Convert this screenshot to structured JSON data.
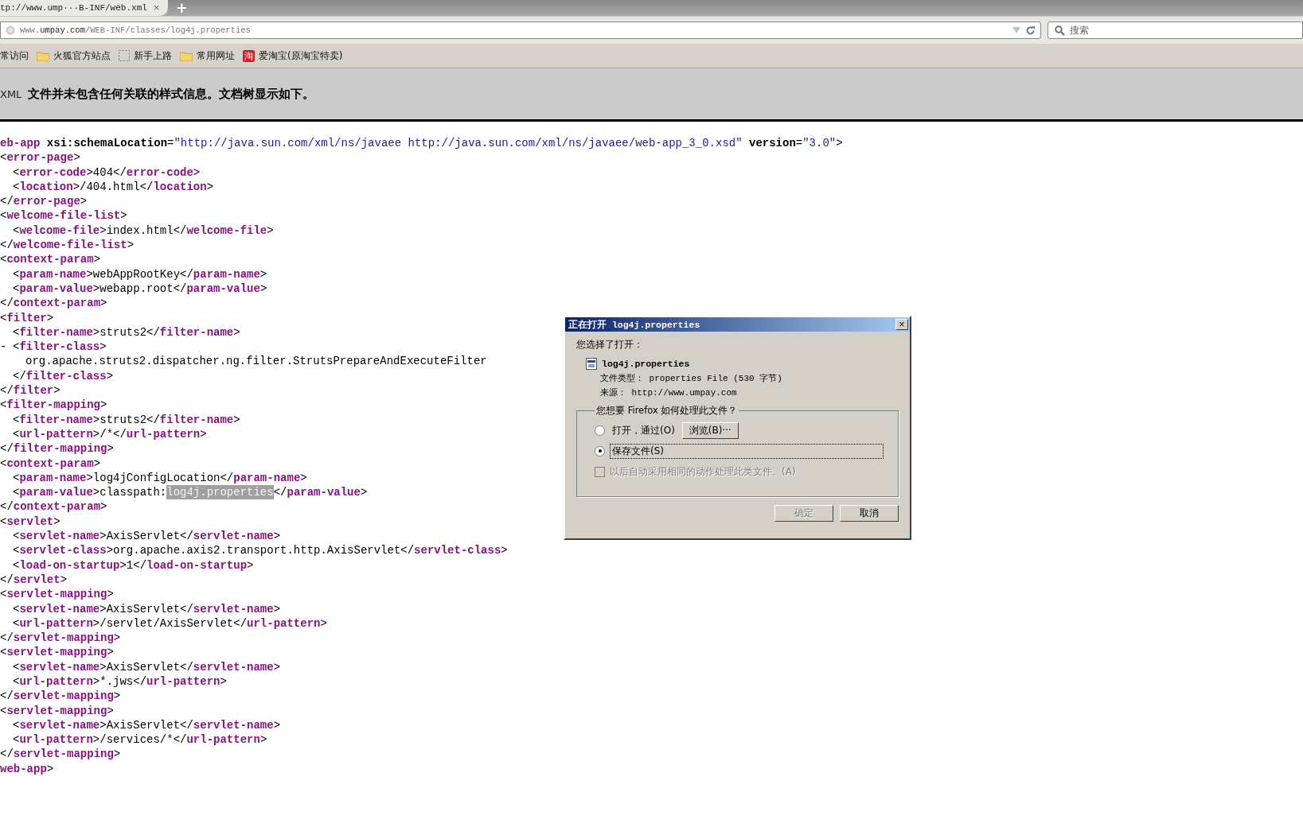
{
  "tab": {
    "title": "tp://www.ump···B-INF/web.xml",
    "close": "×",
    "new_tab": "+"
  },
  "address_bar": {
    "url": "www.**umpay.com**/WEB-INF/classes/log4j.properties"
  },
  "search": {
    "placeholder": "搜索"
  },
  "bookmarks": [
    {
      "kind": "plain",
      "label": "常访问"
    },
    {
      "kind": "folder",
      "label": "火狐官方站点"
    },
    {
      "kind": "blank",
      "label": "新手上路"
    },
    {
      "kind": "folder",
      "label": "常用网址"
    },
    {
      "kind": "badge",
      "badge": "淘",
      "label": "爱淘宝(原淘宝特卖)"
    }
  ],
  "info_bar": {
    "prefix": "XML",
    "message": "文件并未包含任何关联的样式信息。文档树显示如下。"
  },
  "xml": [
    {
      "parts": [
        {
          "kind": "tag",
          "text": "eb-app"
        },
        {
          "kind": "attr",
          "text": " xsi:schemaLocation"
        },
        {
          "kind": "plain",
          "text": "="
        },
        {
          "kind": "value",
          "text": "\"http://java.sun.com/xml/ns/javaee http://java.sun.com/xml/ns/javaee/web-app_3_0.xsd\""
        },
        {
          "kind": "attr",
          "text": " version"
        },
        {
          "kind": "plain",
          "text": "="
        },
        {
          "kind": "value",
          "text": "\"3.0\""
        },
        {
          "kind": "plain",
          "text": ">"
        }
      ]
    },
    {
      "parts": [
        {
          "kind": "plain",
          "text": "<"
        },
        {
          "kind": "tag",
          "text": "error-page"
        },
        {
          "kind": "plain",
          "text": ">"
        }
      ],
      "children": [
        {
          "parts": [
            {
              "kind": "plain",
              "text": "<"
            },
            {
              "kind": "tag",
              "text": "error-code"
            },
            {
              "kind": "plain",
              "text": ">404</"
            },
            {
              "kind": "tag",
              "text": "error-code"
            },
            {
              "kind": "plain",
              "text": ">"
            }
          ]
        },
        {
          "parts": [
            {
              "kind": "plain",
              "text": "<"
            },
            {
              "kind": "tag",
              "text": "location"
            },
            {
              "kind": "plain",
              "text": ">/404.html</"
            },
            {
              "kind": "tag",
              "text": "location"
            },
            {
              "kind": "plain",
              "text": ">"
            }
          ]
        }
      ]
    },
    {
      "parts": [
        {
          "kind": "plain",
          "text": "</"
        },
        {
          "kind": "tag",
          "text": "error-page"
        },
        {
          "kind": "plain",
          "text": ">"
        }
      ]
    },
    {
      "parts": [
        {
          "kind": "plain",
          "text": "<"
        },
        {
          "kind": "tag",
          "text": "welcome-file-list"
        },
        {
          "kind": "plain",
          "text": ">"
        }
      ],
      "children": [
        {
          "parts": [
            {
              "kind": "plain",
              "text": "<"
            },
            {
              "kind": "tag",
              "text": "welcome-file"
            },
            {
              "kind": "plain",
              "text": ">index.html</"
            },
            {
              "kind": "tag",
              "text": "welcome-file"
            },
            {
              "kind": "plain",
              "text": ">"
            }
          ]
        }
      ]
    },
    {
      "parts": [
        {
          "kind": "plain",
          "text": "</"
        },
        {
          "kind": "tag",
          "text": "welcome-file-list"
        },
        {
          "kind": "plain",
          "text": ">"
        }
      ]
    },
    {
      "parts": [
        {
          "kind": "plain",
          "text": "<"
        },
        {
          "kind": "tag",
          "text": "context-param"
        },
        {
          "kind": "plain",
          "text": ">"
        }
      ],
      "children": [
        {
          "parts": [
            {
              "kind": "plain",
              "text": "<"
            },
            {
              "kind": "tag",
              "text": "param-name"
            },
            {
              "kind": "plain",
              "text": ">webAppRootKey</"
            },
            {
              "kind": "tag",
              "text": "param-name"
            },
            {
              "kind": "plain",
              "text": ">"
            }
          ]
        },
        {
          "parts": [
            {
              "kind": "plain",
              "text": "<"
            },
            {
              "kind": "tag",
              "text": "param-value"
            },
            {
              "kind": "plain",
              "text": ">webapp.root</"
            },
            {
              "kind": "tag",
              "text": "param-value"
            },
            {
              "kind": "plain",
              "text": ">"
            }
          ]
        }
      ]
    },
    {
      "parts": [
        {
          "kind": "plain",
          "text": "</"
        },
        {
          "kind": "tag",
          "text": "context-param"
        },
        {
          "kind": "plain",
          "text": ">"
        }
      ]
    },
    {
      "parts": [
        {
          "kind": "plain",
          "text": "<"
        },
        {
          "kind": "tag",
          "text": "filter"
        },
        {
          "kind": "plain",
          "text": ">"
        }
      ],
      "children": [
        {
          "parts": [
            {
              "kind": "plain",
              "text": "<"
            },
            {
              "kind": "tag",
              "text": "filter-name"
            },
            {
              "kind": "plain",
              "text": ">struts2</"
            },
            {
              "kind": "tag",
              "text": "filter-name"
            },
            {
              "kind": "plain",
              "text": ">"
            }
          ]
        },
        {
          "toggle": "-",
          "parts": [
            {
              "kind": "plain",
              "text": "<"
            },
            {
              "kind": "tag",
              "text": "filter-class"
            },
            {
              "kind": "plain",
              "text": ">"
            }
          ],
          "children": [
            {
              "parts": [
                {
                  "kind": "plain",
                  "text": "org.apache.struts2.dispatcher.ng.filter.StrutsPrepareAndExecuteFilter"
                }
              ]
            }
          ]
        },
        {
          "parts": [
            {
              "kind": "plain",
              "text": "</"
            },
            {
              "kind": "tag",
              "text": "filter-class"
            },
            {
              "kind": "plain",
              "text": ">"
            }
          ]
        }
      ]
    },
    {
      "parts": [
        {
          "kind": "plain",
          "text": "</"
        },
        {
          "kind": "tag",
          "text": "filter"
        },
        {
          "kind": "plain",
          "text": ">"
        }
      ]
    },
    {
      "parts": [
        {
          "kind": "plain",
          "text": "<"
        },
        {
          "kind": "tag",
          "text": "filter-mapping"
        },
        {
          "kind": "plain",
          "text": ">"
        }
      ],
      "children": [
        {
          "parts": [
            {
              "kind": "plain",
              "text": "<"
            },
            {
              "kind": "tag",
              "text": "filter-name"
            },
            {
              "kind": "plain",
              "text": ">struts2</"
            },
            {
              "kind": "tag",
              "text": "filter-name"
            },
            {
              "kind": "plain",
              "text": ">"
            }
          ]
        },
        {
          "parts": [
            {
              "kind": "plain",
              "text": "<"
            },
            {
              "kind": "tag",
              "text": "url-pattern"
            },
            {
              "kind": "plain",
              "text": ">/*</"
            },
            {
              "kind": "tag",
              "text": "url-pattern"
            },
            {
              "kind": "plain",
              "text": ">"
            }
          ]
        }
      ]
    },
    {
      "parts": [
        {
          "kind": "plain",
          "text": "</"
        },
        {
          "kind": "tag",
          "text": "filter-mapping"
        },
        {
          "kind": "plain",
          "text": ">"
        }
      ]
    },
    {
      "parts": [
        {
          "kind": "plain",
          "text": "<"
        },
        {
          "kind": "tag",
          "text": "context-param"
        },
        {
          "kind": "plain",
          "text": ">"
        }
      ],
      "children": [
        {
          "parts": [
            {
              "kind": "plain",
              "text": "<"
            },
            {
              "kind": "tag",
              "text": "param-name"
            },
            {
              "kind": "plain",
              "text": ">log4jConfigLocation</"
            },
            {
              "kind": "tag",
              "text": "param-name"
            },
            {
              "kind": "plain",
              "text": ">"
            }
          ]
        },
        {
          "parts": [
            {
              "kind": "plain",
              "text": "<"
            },
            {
              "kind": "tag",
              "text": "param-value"
            },
            {
              "kind": "plain",
              "text": ">classpath:"
            },
            {
              "kind": "highlight",
              "text": "log4j.properties"
            },
            {
              "kind": "plain",
              "text": "</"
            },
            {
              "kind": "tag",
              "text": "param-value"
            },
            {
              "kind": "plain",
              "text": ">"
            }
          ]
        }
      ]
    },
    {
      "parts": [
        {
          "kind": "plain",
          "text": "</"
        },
        {
          "kind": "tag",
          "text": "context-param"
        },
        {
          "kind": "plain",
          "text": ">"
        }
      ]
    },
    {
      "parts": [
        {
          "kind": "plain",
          "text": "<"
        },
        {
          "kind": "tag",
          "text": "servlet"
        },
        {
          "kind": "plain",
          "text": ">"
        }
      ],
      "children": [
        {
          "parts": [
            {
              "kind": "plain",
              "text": "<"
            },
            {
              "kind": "tag",
              "text": "servlet-name"
            },
            {
              "kind": "plain",
              "text": ">AxisServlet</"
            },
            {
              "kind": "tag",
              "text": "servlet-name"
            },
            {
              "kind": "plain",
              "text": ">"
            }
          ]
        },
        {
          "parts": [
            {
              "kind": "plain",
              "text": "<"
            },
            {
              "kind": "tag",
              "text": "servlet-class"
            },
            {
              "kind": "plain",
              "text": ">org.apache.axis2.transport.http.AxisServlet</"
            },
            {
              "kind": "tag",
              "text": "servlet-class"
            },
            {
              "kind": "plain",
              "text": ">"
            }
          ]
        },
        {
          "parts": [
            {
              "kind": "plain",
              "text": "<"
            },
            {
              "kind": "tag",
              "text": "load-on-startup"
            },
            {
              "kind": "plain",
              "text": ">1</"
            },
            {
              "kind": "tag",
              "text": "load-on-startup"
            },
            {
              "kind": "plain",
              "text": ">"
            }
          ]
        }
      ]
    },
    {
      "parts": [
        {
          "kind": "plain",
          "text": "</"
        },
        {
          "kind": "tag",
          "text": "servlet"
        },
        {
          "kind": "plain",
          "text": ">"
        }
      ]
    },
    {
      "parts": [
        {
          "kind": "plain",
          "text": "<"
        },
        {
          "kind": "tag",
          "text": "servlet-mapping"
        },
        {
          "kind": "plain",
          "text": ">"
        }
      ],
      "children": [
        {
          "parts": [
            {
              "kind": "plain",
              "text": "<"
            },
            {
              "kind": "tag",
              "text": "servlet-name"
            },
            {
              "kind": "plain",
              "text": ">AxisServlet</"
            },
            {
              "kind": "tag",
              "text": "servlet-name"
            },
            {
              "kind": "plain",
              "text": ">"
            }
          ]
        },
        {
          "parts": [
            {
              "kind": "plain",
              "text": "<"
            },
            {
              "kind": "tag",
              "text": "url-pattern"
            },
            {
              "kind": "plain",
              "text": ">/servlet/AxisServlet</"
            },
            {
              "kind": "tag",
              "text": "url-pattern"
            },
            {
              "kind": "plain",
              "text": ">"
            }
          ]
        }
      ]
    },
    {
      "parts": [
        {
          "kind": "plain",
          "text": "</"
        },
        {
          "kind": "tag",
          "text": "servlet-mapping"
        },
        {
          "kind": "plain",
          "text": ">"
        }
      ]
    },
    {
      "parts": [
        {
          "kind": "plain",
          "text": "<"
        },
        {
          "kind": "tag",
          "text": "servlet-mapping"
        },
        {
          "kind": "plain",
          "text": ">"
        }
      ],
      "children": [
        {
          "parts": [
            {
              "kind": "plain",
              "text": "<"
            },
            {
              "kind": "tag",
              "text": "servlet-name"
            },
            {
              "kind": "plain",
              "text": ">AxisServlet</"
            },
            {
              "kind": "tag",
              "text": "servlet-name"
            },
            {
              "kind": "plain",
              "text": ">"
            }
          ]
        },
        {
          "parts": [
            {
              "kind": "plain",
              "text": "<"
            },
            {
              "kind": "tag",
              "text": "url-pattern"
            },
            {
              "kind": "plain",
              "text": ">*.jws</"
            },
            {
              "kind": "tag",
              "text": "url-pattern"
            },
            {
              "kind": "plain",
              "text": ">"
            }
          ]
        }
      ]
    },
    {
      "parts": [
        {
          "kind": "plain",
          "text": "</"
        },
        {
          "kind": "tag",
          "text": "servlet-mapping"
        },
        {
          "kind": "plain",
          "text": ">"
        }
      ]
    },
    {
      "parts": [
        {
          "kind": "plain",
          "text": "<"
        },
        {
          "kind": "tag",
          "text": "servlet-mapping"
        },
        {
          "kind": "plain",
          "text": ">"
        }
      ],
      "children": [
        {
          "parts": [
            {
              "kind": "plain",
              "text": "<"
            },
            {
              "kind": "tag",
              "text": "servlet-name"
            },
            {
              "kind": "plain",
              "text": ">AxisServlet</"
            },
            {
              "kind": "tag",
              "text": "servlet-name"
            },
            {
              "kind": "plain",
              "text": ">"
            }
          ]
        },
        {
          "parts": [
            {
              "kind": "plain",
              "text": "<"
            },
            {
              "kind": "tag",
              "text": "url-pattern"
            },
            {
              "kind": "plain",
              "text": ">/services/*</"
            },
            {
              "kind": "tag",
              "text": "url-pattern"
            },
            {
              "kind": "plain",
              "text": ">"
            }
          ]
        }
      ]
    },
    {
      "parts": [
        {
          "kind": "plain",
          "text": "</"
        },
        {
          "kind": "tag",
          "text": "servlet-mapping"
        },
        {
          "kind": "plain",
          "text": ">"
        }
      ]
    },
    {
      "parts": [
        {
          "kind": "tag",
          "text": "web-app"
        },
        {
          "kind": "plain",
          "text": ">"
        }
      ]
    }
  ],
  "dialog": {
    "title": "正在打开 log4j.properties",
    "close": "×",
    "intro": "您选择了打开：",
    "file_name": "log4j.properties",
    "file_type_label": "文件类型：",
    "file_type": "properties File (530 字节)",
    "source_label": "来源：",
    "source": "http://www.umpay.com",
    "group_label": "您想要 Firefox 如何处理此文件？",
    "options": [
      {
        "label": "打开，通过(O)",
        "selected": false,
        "focused": false
      },
      {
        "label": "保存文件(S)",
        "selected": true,
        "focused": true
      }
    ],
    "browse_button": "浏览(B)···",
    "remember": {
      "label": "以后自动采用相同的动作处理此类文件。(A)",
      "checked": false,
      "disabled": true
    },
    "buttons": [
      {
        "label": "确定",
        "disabled": true
      },
      {
        "label": "取消",
        "disabled": false
      }
    ]
  }
}
